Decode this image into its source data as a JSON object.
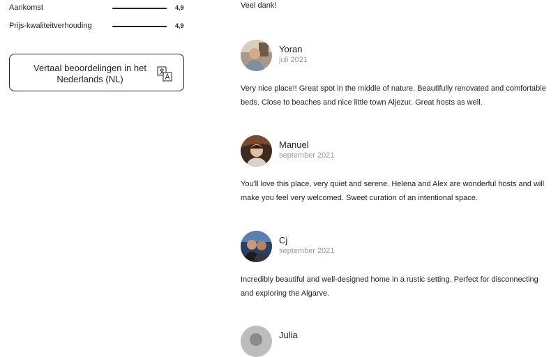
{
  "ratings": [
    {
      "label": "Aankomst",
      "value": "4,9",
      "fraction": 0.98
    },
    {
      "label": "Prijs-kwaliteitverhouding",
      "value": "4,9",
      "fraction": 0.98
    }
  ],
  "translate_button": {
    "label": "Vertaal beoordelingen in het Nederlands (NL)",
    "icon": "translate-icon"
  },
  "intro_text": "Veel dank!",
  "reviews": [
    {
      "name": "Yoran",
      "date": "juli 2021",
      "text": "Very nice place!! Great spot in the middle of nature. Beautifully renovated and comfortable beds. Close to beaches and nice little town Aljezur. Great hosts as well."
    },
    {
      "name": "Manuel",
      "date": "september 2021",
      "text": "You'll love this place, very quiet and serene. Helena and Alex are wonderful hosts and will make you feel very welcomed. Sweet curation of an intentional space."
    },
    {
      "name": "Cj",
      "date": "september 2021",
      "text": "Incredibly beautiful and well-designed home in a rustic setting. Perfect for disconnecting and exploring the Algarve."
    },
    {
      "name": "Julia",
      "date": "",
      "text": ""
    }
  ],
  "colors": {
    "text": "#222222",
    "muted": "#9a9a9a",
    "bar_bg": "#d9d9d9"
  }
}
